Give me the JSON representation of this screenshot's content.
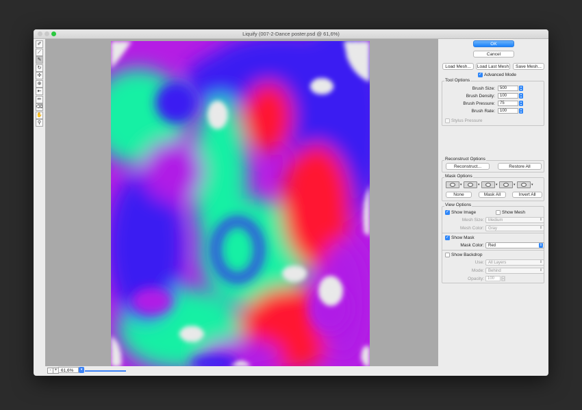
{
  "window": {
    "title": "Liquify (007-2-Dance poster.psd @ 61,6%)"
  },
  "toolbar": {
    "tools": [
      {
        "icon": "forward-warp-tool-icon"
      },
      {
        "icon": "reconstruct-brush-icon"
      },
      {
        "icon": "smooth-tool-icon"
      },
      {
        "icon": "twirl-clockwise-icon"
      },
      {
        "icon": "pucker-tool-icon"
      },
      {
        "icon": "bloat-tool-icon"
      },
      {
        "icon": "push-left-tool-icon"
      },
      {
        "icon": "freeze-mask-icon"
      },
      {
        "icon": "thaw-mask-icon"
      },
      {
        "icon": "hand-tool-icon"
      },
      {
        "icon": "zoom-tool-icon"
      }
    ]
  },
  "status": {
    "zoom_minus": "-",
    "zoom_plus": "+",
    "zoom_value": "61,6%"
  },
  "panel": {
    "ok_label": "OK",
    "cancel_label": "Cancel",
    "load_mesh_label": "Load Mesh...",
    "load_last_mesh_label": "Load Last Mesh",
    "save_mesh_label": "Save Mesh...",
    "advanced_mode_label": "Advanced Mode",
    "tool_options": {
      "title": "Tool Options",
      "brush_size_label": "Brush Size:",
      "brush_size_value": "500",
      "brush_density_label": "Brush Density:",
      "brush_density_value": "100",
      "brush_pressure_label": "Brush Pressure:",
      "brush_pressure_value": "75",
      "brush_rate_label": "Brush Rate:",
      "brush_rate_value": "100",
      "stylus_pressure_label": "Stylus Pressure"
    },
    "reconstruct_options": {
      "title": "Reconstruct Options",
      "reconstruct_label": "Reconstruct...",
      "restore_all_label": "Restore All"
    },
    "mask_options": {
      "title": "Mask Options",
      "none_label": "None",
      "mask_all_label": "Mask All",
      "invert_all_label": "Invert All"
    },
    "view_options": {
      "title": "View Options",
      "show_image_label": "Show Image",
      "show_mesh_label": "Show Mesh",
      "mesh_size_label": "Mesh Size:",
      "mesh_size_value": "Medium",
      "mesh_color_label": "Mesh Color:",
      "mesh_color_value": "Gray",
      "show_mask_label": "Show Mask",
      "mask_color_label": "Mask Color:",
      "mask_color_value": "Red",
      "show_backdrop_label": "Show Backdrop",
      "use_label": "Use:",
      "use_value": "All Layers",
      "mode_label": "Mode:",
      "mode_value": "Behind",
      "opacity_label": "Opacity:",
      "opacity_value": "100"
    }
  },
  "colors": {
    "accent": "#2e86f8",
    "poster_blue": "#3a1cf2",
    "poster_green": "#18f0a4",
    "poster_red": "#ff1730",
    "poster_purple": "#b01ce6"
  }
}
